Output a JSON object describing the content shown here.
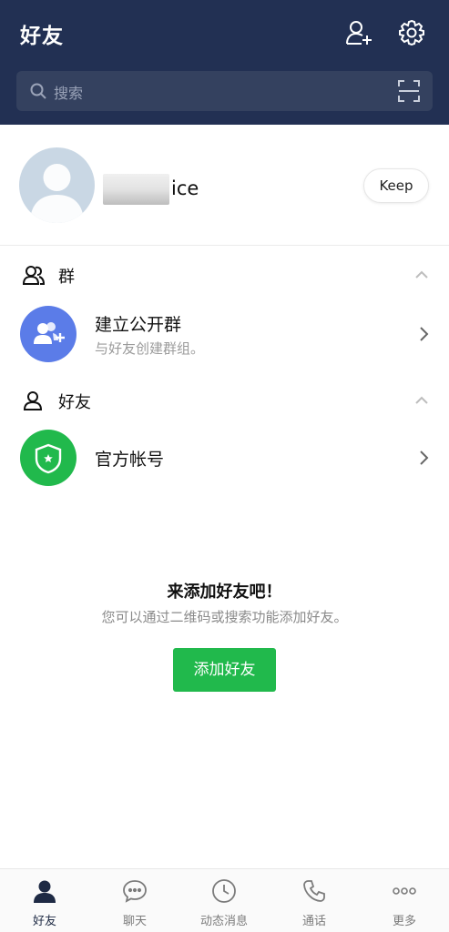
{
  "header": {
    "title": "好友",
    "add_friend_icon": "add-user-icon",
    "settings_icon": "gear-icon",
    "background": "#223053"
  },
  "search": {
    "placeholder": "搜索",
    "icon": "search-icon",
    "scan_icon": "qr-scan-icon"
  },
  "profile": {
    "name_visible": "ice",
    "keep_label": "Keep"
  },
  "groups_section": {
    "label": "群",
    "icon": "group-icon",
    "collapse_icon": "chevron-up-icon",
    "rows": [
      {
        "title": "建立公开群",
        "subtitle": "与好友创建群组。",
        "icon": "add-group-icon",
        "color": "#5b7ce8"
      }
    ]
  },
  "friends_section": {
    "label": "好友",
    "icon": "person-icon",
    "collapse_icon": "chevron-up-icon",
    "rows": [
      {
        "title": "官方帐号",
        "icon": "shield-star-icon",
        "color": "#21b94c"
      }
    ]
  },
  "empty_state": {
    "title": "来添加好友吧！",
    "subtitle": "您可以通过二维码或搜索功能添加好友。",
    "button_label": "添加好友",
    "button_color": "#21b94c"
  },
  "tabbar": {
    "items": [
      {
        "label": "好友",
        "icon": "person-icon",
        "active": true
      },
      {
        "label": "聊天",
        "icon": "chat-bubble-icon",
        "active": false
      },
      {
        "label": "动态消息",
        "icon": "clock-icon",
        "active": false
      },
      {
        "label": "通话",
        "icon": "phone-icon",
        "active": false
      },
      {
        "label": "更多",
        "icon": "more-dots-icon",
        "active": false
      }
    ]
  }
}
